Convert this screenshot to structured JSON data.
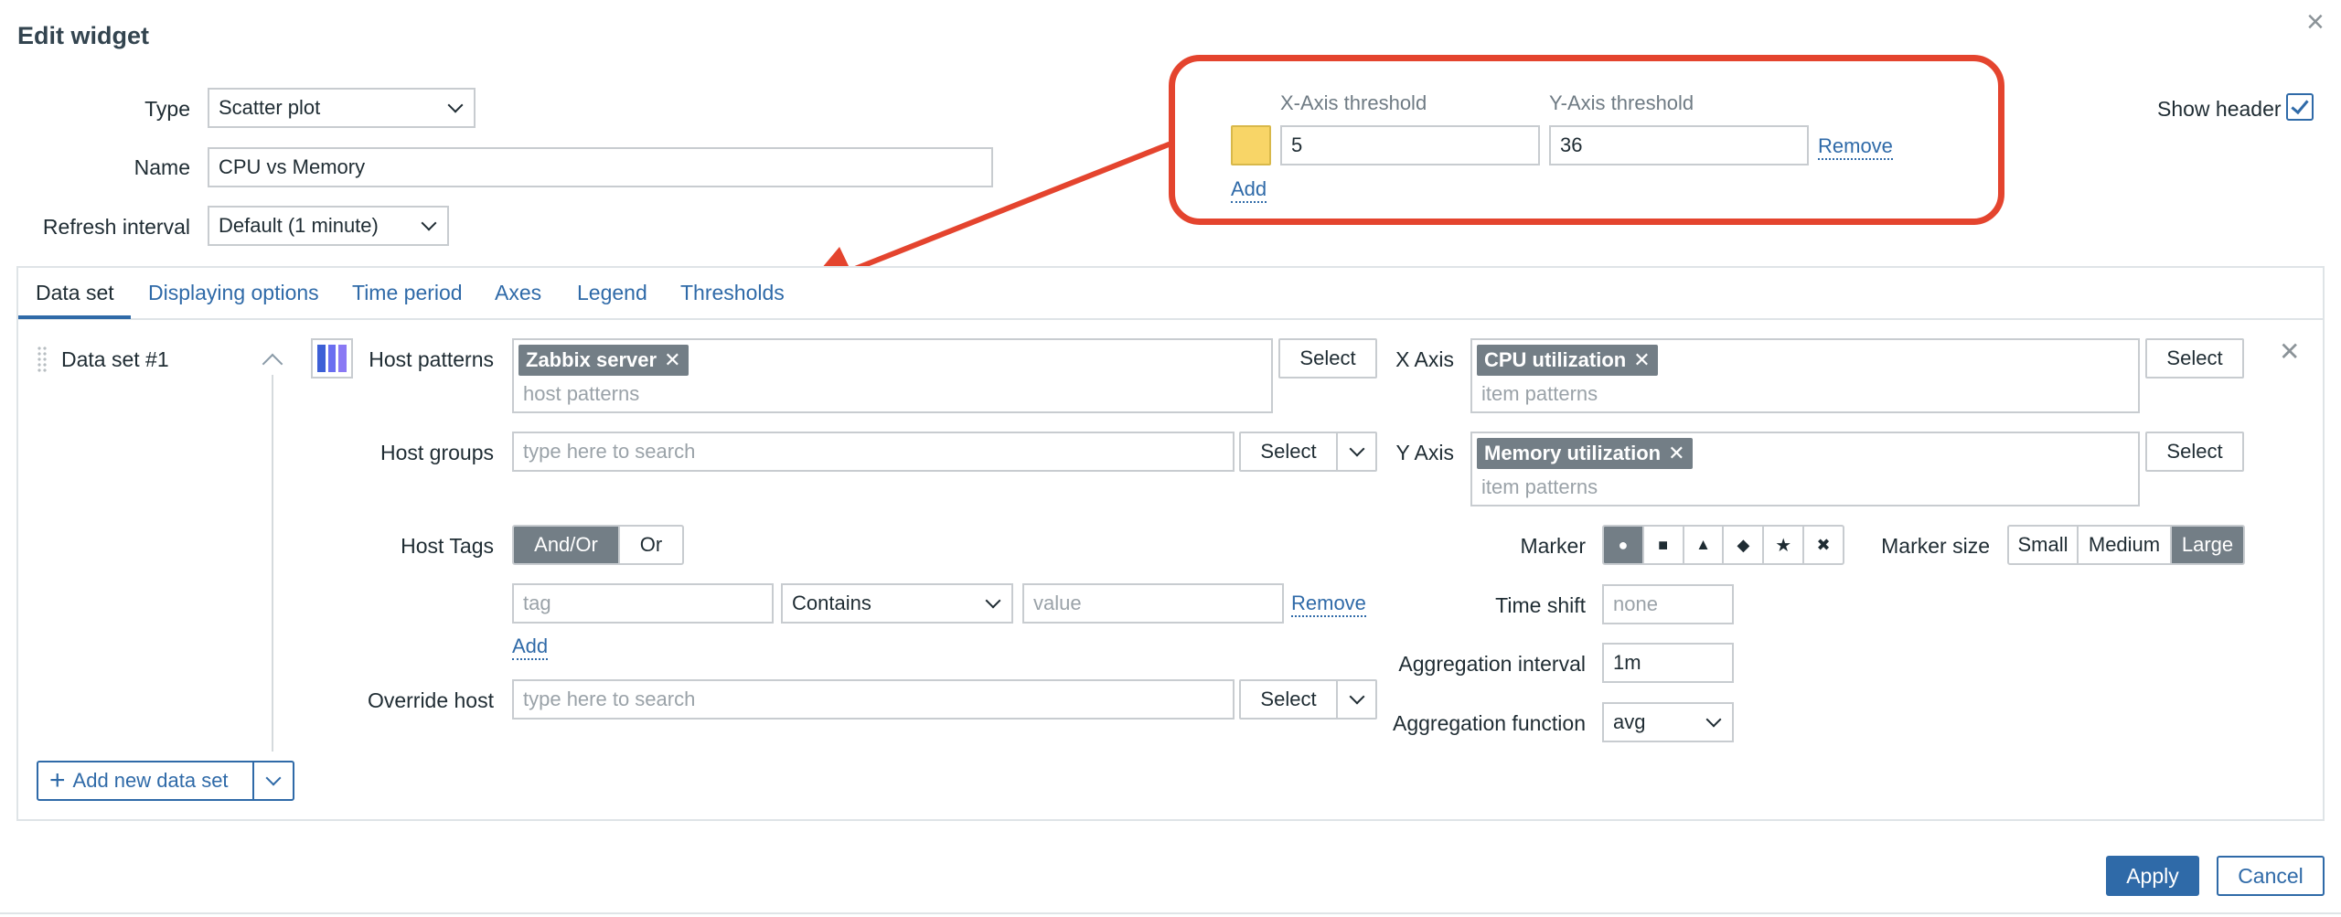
{
  "dialog": {
    "title": "Edit widget",
    "close_glyph": "×",
    "show_header_label": "Show header",
    "show_header_checked": true
  },
  "form": {
    "type_label": "Type",
    "type_value": "Scatter plot",
    "name_label": "Name",
    "name_value": "CPU vs Memory",
    "refresh_label": "Refresh interval",
    "refresh_value": "Default (1 minute)"
  },
  "thresholds_callout": {
    "x_label": "X-Axis threshold",
    "y_label": "Y-Axis threshold",
    "x_value": "5",
    "y_value": "36",
    "color": "#f8d567",
    "remove_label": "Remove",
    "add_label": "Add",
    "highlight_color": "#e4442e"
  },
  "tabs": [
    "Data set",
    "Displaying options",
    "Time period",
    "Axes",
    "Legend",
    "Thresholds"
  ],
  "active_tab": "Data set",
  "dataset": {
    "name": "Data set #1",
    "host_patterns_label": "Host patterns",
    "host_tag": "Zabbix server",
    "host_patterns_placeholder": "host patterns",
    "select_label": "Select",
    "x_axis_label": "X Axis",
    "x_axis_tag": "CPU utilization",
    "item_placeholder": "item patterns",
    "host_groups_label": "Host groups",
    "search_placeholder": "type here to search",
    "y_axis_label": "Y Axis",
    "y_axis_tag": "Memory utilization",
    "host_tags_label": "Host Tags",
    "and_or_label": "And/Or",
    "or_label": "Or",
    "tag_placeholder": "tag",
    "operator_value": "Contains",
    "value_placeholder": "value",
    "remove_label": "Remove",
    "add_label": "Add",
    "override_host_label": "Override host",
    "marker_label": "Marker",
    "marker_icons": [
      "circle-icon",
      "square-icon",
      "triangle-icon",
      "diamond-icon",
      "star-icon",
      "cross-icon"
    ],
    "marker_glyphs": [
      "●",
      "■",
      "▲",
      "◆",
      "★",
      "✖"
    ],
    "marker_size_label": "Marker size",
    "marker_sizes": [
      "Small",
      "Medium",
      "Large"
    ],
    "marker_size_selected": "Large",
    "time_shift_label": "Time shift",
    "time_shift_placeholder": "none",
    "agg_interval_label": "Aggregation interval",
    "agg_interval_value": "1m",
    "agg_function_label": "Aggregation function",
    "agg_function_value": "avg",
    "add_dataset_label": "Add new data set",
    "palette_colors": [
      "#3d5fd6",
      "#6a6ef0",
      "#8a79f4"
    ]
  },
  "footer": {
    "apply_label": "Apply",
    "cancel_label": "Cancel",
    "accent": "#2f6aa8"
  }
}
